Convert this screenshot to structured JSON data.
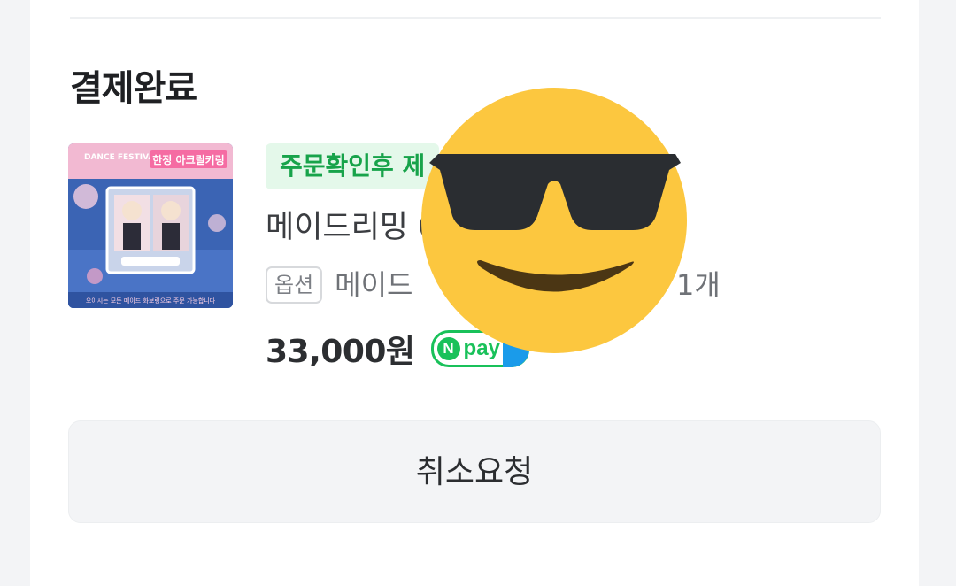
{
  "order": {
    "status_title": "결제완료",
    "badge": "주문확인후 제",
    "product_name": "메이드리밍                      026년 한…",
    "option_tag": "옵션",
    "option_text": "메이드",
    "quantity": "1개",
    "price": "33,000원"
  },
  "thumbnail": {
    "banner_text": "한정 아크릴키링",
    "festival_text": "DANCE FESTIVAL",
    "footer_text": "오이시는 모든 메이드 화보링으로 주문 가능합니다"
  },
  "npay": {
    "n_letter": "N",
    "label": "pay"
  },
  "actions": {
    "cancel_request": "취소요청"
  },
  "colors": {
    "badge_bg": "#e4f8ea",
    "badge_text": "#17a34a",
    "npay_green": "#19c15a",
    "npay_blue": "#1a9bea",
    "emoji_yellow": "#fcc73f"
  },
  "overlay": {
    "icon": "sunglasses-smiley-emoji-icon"
  }
}
